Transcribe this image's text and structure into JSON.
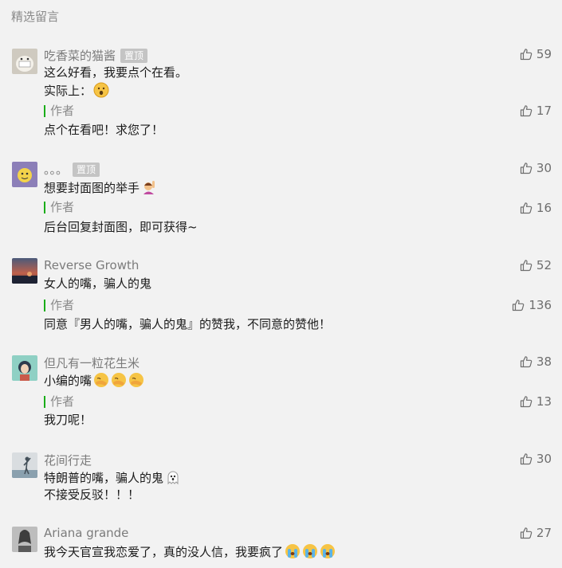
{
  "header": {
    "title": "精选留言"
  },
  "icons": {
    "like": "thumbs-up-icon"
  },
  "colors": {
    "background": "#f2f2f2",
    "author_bar": "#1aad19",
    "badge": "#c4c4c4"
  },
  "comments": [
    {
      "user": "吃香菜的猫酱",
      "badge": "置顶",
      "likes": "59",
      "lines": [
        "这么好看，我要点个在看。",
        "实际上："
      ],
      "reply": {
        "label": "作者",
        "likes": "17",
        "text": "点个在看吧！求您了！"
      }
    },
    {
      "user": "。。。",
      "badge": "置顶",
      "likes": "30",
      "lines": [
        "想要封面图的举手"
      ],
      "reply": {
        "label": "作者",
        "likes": "16",
        "text": "后台回复封面图，即可获得~"
      }
    },
    {
      "user": "Reverse Growth",
      "likes": "52",
      "lines": [
        "女人的嘴，骗人的鬼"
      ],
      "reply": {
        "label": "作者",
        "likes": "136",
        "text": "同意『男人的嘴，骗人的鬼』的赞我，不同意的赞他！"
      }
    },
    {
      "user": "但凡有一粒花生米",
      "likes": "38",
      "lines": [
        "小编的嘴"
      ],
      "reply": {
        "label": "作者",
        "likes": "13",
        "text": "我刀呢！"
      }
    },
    {
      "user": "花间行走",
      "likes": "30",
      "lines": [
        "特朗普的嘴，骗人的鬼",
        "不接受反驳！！！"
      ]
    },
    {
      "user": "Ariana grande",
      "likes": "27",
      "lines": [
        "我今天官宣我恋爱了，真的没人信，我要疯了"
      ]
    }
  ]
}
